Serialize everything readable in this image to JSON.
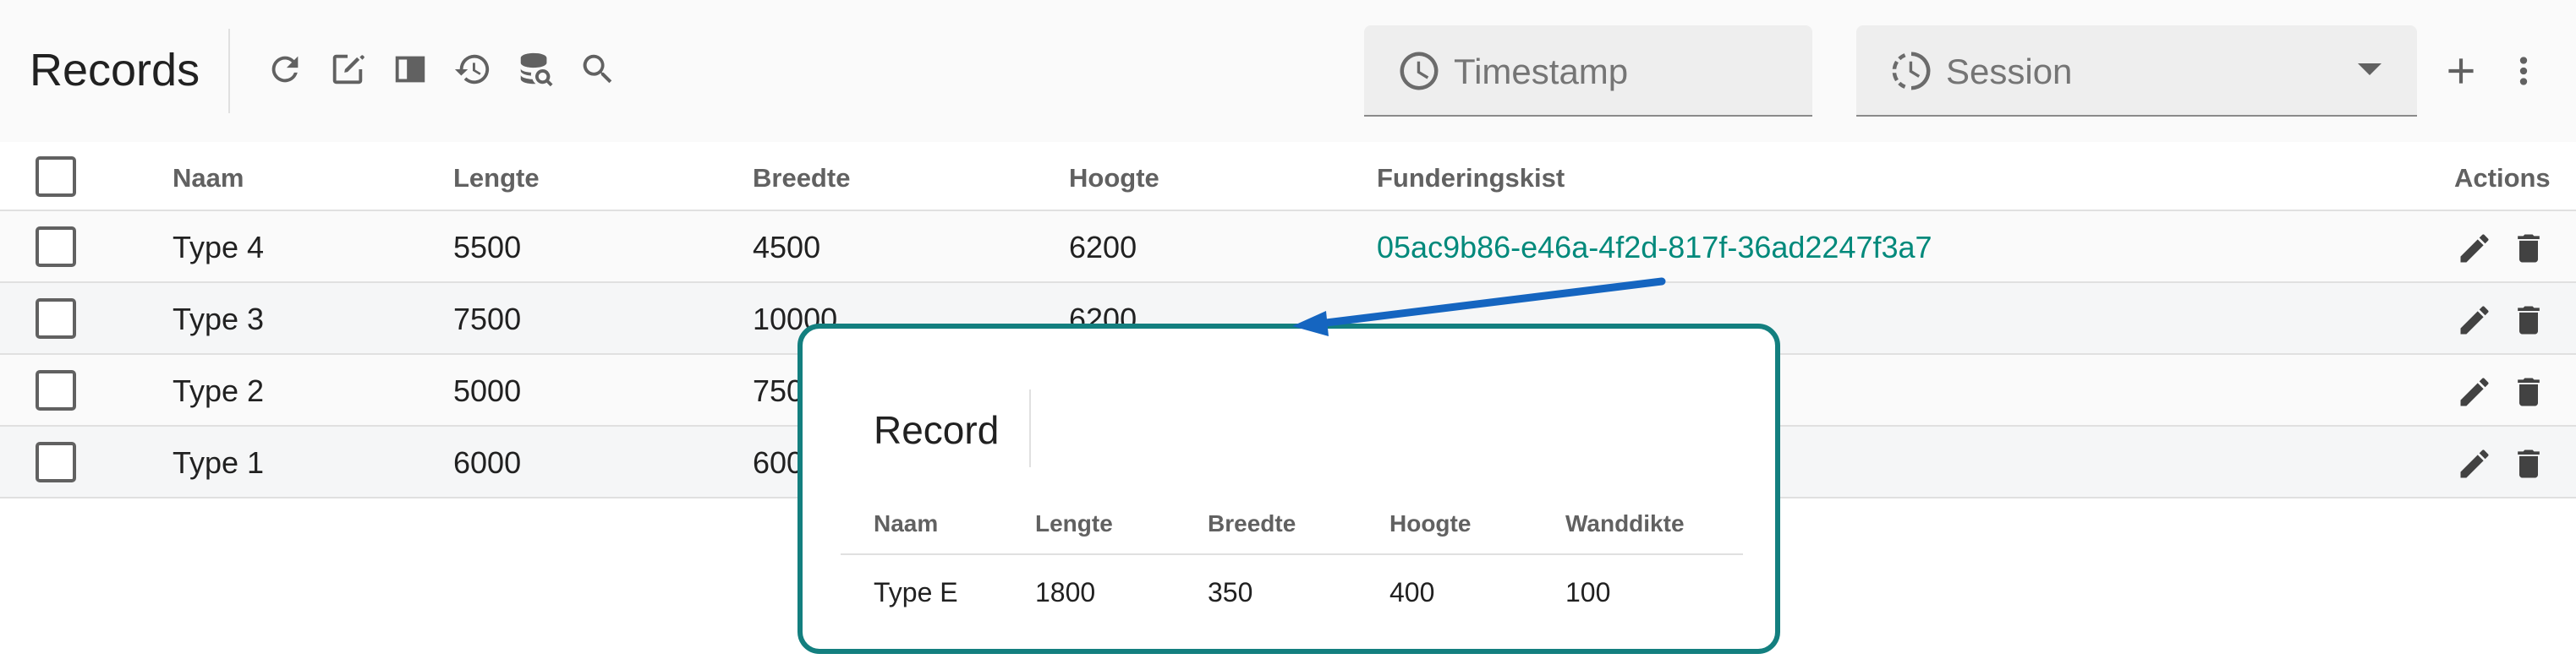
{
  "header": {
    "title": "Records"
  },
  "toolbar_icons": [
    "refresh-icon",
    "edit-note-icon",
    "view-sidebar-icon",
    "history-icon",
    "database-search-icon",
    "search-icon"
  ],
  "filters": {
    "timestamp_label": "Timestamp",
    "session_label": "Session"
  },
  "table": {
    "columns": [
      "Naam",
      "Lengte",
      "Breedte",
      "Hoogte",
      "Funderingskist",
      "Actions"
    ],
    "rows": [
      {
        "naam": "Type 4",
        "lengte": "5500",
        "breedte": "4500",
        "hoogte": "6200",
        "funderingskist": "05ac9b86-e46a-4f2d-817f-36ad2247f3a7"
      },
      {
        "naam": "Type 3",
        "lengte": "7500",
        "breedte": "10000",
        "hoogte": "6200",
        "funderingskist": ""
      },
      {
        "naam": "Type 2",
        "lengte": "5000",
        "breedte": "750",
        "hoogte": "",
        "funderingskist": ""
      },
      {
        "naam": "Type 1",
        "lengte": "6000",
        "breedte": "600",
        "hoogte": "",
        "funderingskist": ""
      }
    ]
  },
  "popup": {
    "title": "Record",
    "columns": [
      "Naam",
      "Lengte",
      "Breedte",
      "Hoogte",
      "Wanddikte"
    ],
    "row": {
      "naam": "Type E",
      "lengte": "1800",
      "breedte": "350",
      "hoogte": "400",
      "wanddikte": "100"
    }
  },
  "colors": {
    "accent": "#00897b",
    "callout_border": "#137f7f",
    "arrow": "#1565c0"
  }
}
